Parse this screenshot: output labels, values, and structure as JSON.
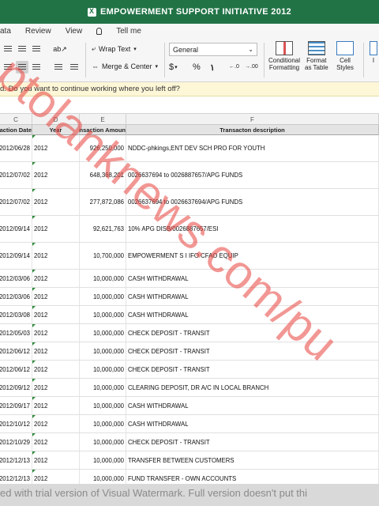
{
  "window": {
    "title": "EMPOWERMENT SUPPORT INITIATIVE  2012"
  },
  "menu": {
    "items": [
      "ata",
      "Review",
      "View"
    ],
    "tell_me": "Tell me"
  },
  "ribbon": {
    "wrap_text": "Wrap Text",
    "merge_center": "Merge & Center",
    "number_format": "General",
    "currency_symbol": "$",
    "percent_symbol": "%",
    "comma_symbol": "١",
    "increase_decimal": "←.0",
    "decrease_decimal": "→.00",
    "conditional_formatting": [
      "Conditional",
      "Formatting"
    ],
    "format_as_table": [
      "Format",
      "as Table"
    ],
    "cell_styles": [
      "Cell",
      "Styles"
    ],
    "insert_partial": "I"
  },
  "notice": {
    "text": "d. Do you want to continue working where you left off?"
  },
  "columns": [
    "C",
    "D",
    "E",
    "F"
  ],
  "headers": {
    "c": "action Date",
    "d": "Year",
    "e": "ransaction Amoun",
    "f": "Transacton description"
  },
  "rows": [
    {
      "date": "2012/06/28",
      "year": "2012",
      "amount": "926,250,000",
      "desc": "NDDC-phkings,ENT DEV SCH PRO FOR YOUTH"
    },
    {
      "date": "2012/07/02",
      "year": "2012",
      "amount": "648,368,201",
      "desc": "0026637694 to 0026887657/APG FUNDS"
    },
    {
      "date": "2012/07/02",
      "year": "2012",
      "amount": "277,872,086",
      "desc": "0026637694 to 0026637694/APG FUNDS"
    },
    {
      "date": "2012/09/14",
      "year": "2012",
      "amount": "92,621,763",
      "desc": "10% APG DISB/0026887657/ESI"
    },
    {
      "date": "2012/09/14",
      "year": "2012",
      "amount": "10,700,000",
      "desc": "EMPOWERMENT S I IFO CFAO EQUIP"
    },
    {
      "date": "2012/03/06",
      "year": "2012",
      "amount": "10,000,000",
      "desc": "CASH WITHDRAWAL"
    },
    {
      "date": "2012/03/06",
      "year": "2012",
      "amount": "10,000,000",
      "desc": "CASH WITHDRAWAL"
    },
    {
      "date": "2012/03/08",
      "year": "2012",
      "amount": "10,000,000",
      "desc": "CASH WITHDRAWAL"
    },
    {
      "date": "2012/05/03",
      "year": "2012",
      "amount": "10,000,000",
      "desc": "CHECK DEPOSIT - TRANSIT"
    },
    {
      "date": "2012/06/12",
      "year": "2012",
      "amount": "10,000,000",
      "desc": "CHECK DEPOSIT - TRANSIT"
    },
    {
      "date": "2012/06/12",
      "year": "2012",
      "amount": "10,000,000",
      "desc": "CHECK DEPOSIT - TRANSIT"
    },
    {
      "date": "2012/09/12",
      "year": "2012",
      "amount": "10,000,000",
      "desc": "CLEARING DEPOSIT, DR A/C IN LOCAL BRANCH"
    },
    {
      "date": "2012/09/17",
      "year": "2012",
      "amount": "10,000,000",
      "desc": "CASH WITHDRAWAL"
    },
    {
      "date": "2012/10/12",
      "year": "2012",
      "amount": "10,000,000",
      "desc": "CASH WITHDRAWAL"
    },
    {
      "date": "2012/10/29",
      "year": "2012",
      "amount": "10,000,000",
      "desc": "CHECK DEPOSIT - TRANSIT"
    },
    {
      "date": "2012/12/13",
      "year": "2012",
      "amount": "10,000,000",
      "desc": "TRANSFER BETWEEN CUSTOMERS"
    },
    {
      "date": "2012/12/13",
      "year": "2012",
      "amount": "10,000,000",
      "desc": "FUND TRANSFER - OWN ACCOUNTS"
    }
  ],
  "watermark": {
    "diagonal": "ptolanknews.com/pu",
    "bottom": "ed with trial version of Visual Watermark. Full version doesn't put thi"
  },
  "colors": {
    "excel_green": "#217346",
    "notice_bg": "#fdf6d7",
    "watermark_red": "#e8413c"
  }
}
